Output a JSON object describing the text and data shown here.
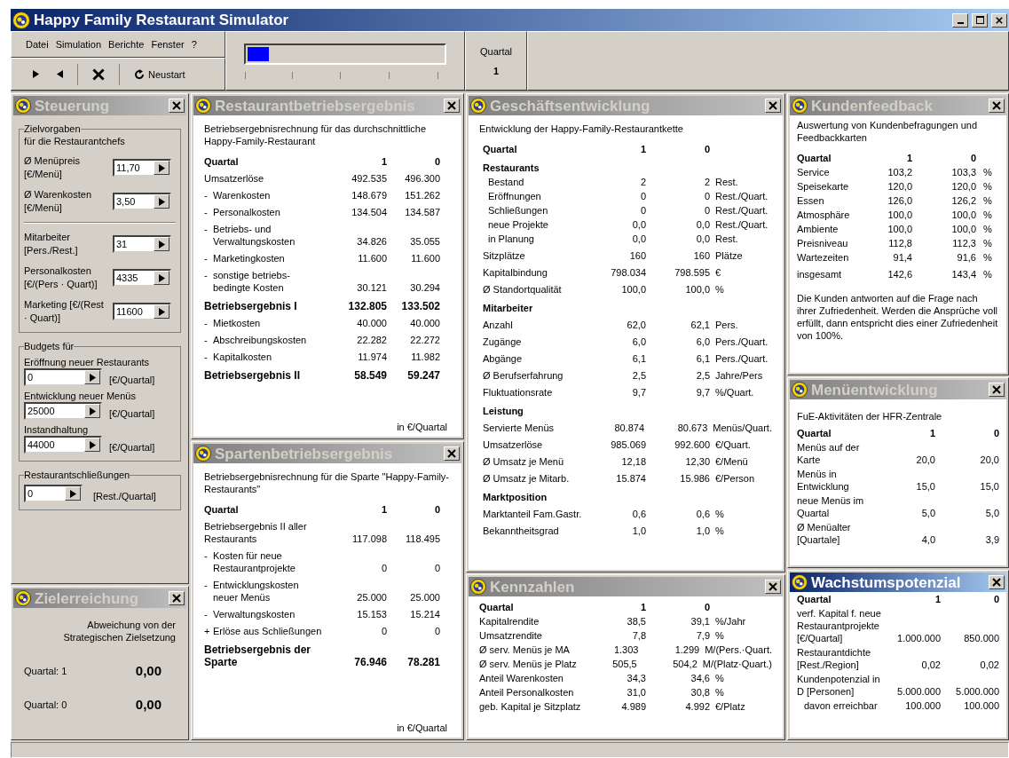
{
  "window": {
    "title": "Happy Family Restaurant Simulator"
  },
  "menu": [
    "Datei",
    "Simulation",
    "Berichte",
    "Fenster",
    "?"
  ],
  "toolbar": {
    "restart": "Neustart"
  },
  "progress": {
    "level": 0.11
  },
  "quarter": {
    "label": "Quartal",
    "value": "1"
  },
  "steuerung": {
    "title": "Steuerung",
    "selected": false,
    "groups": [
      {
        "legend": "Zielvorgaben",
        "subtitle": "für die Restaurantchefs",
        "fields": [
          {
            "kind": "side",
            "label": "Ø Menüpreis [€/Menü]",
            "value": "11,70"
          },
          {
            "kind": "side",
            "label": "Ø Warenkosten [€/Menü]",
            "value": "3,50"
          },
          {
            "kind": "separator"
          },
          {
            "kind": "side",
            "label": "Mitarbeiter [Pers./Rest.]",
            "value": "31"
          },
          {
            "kind": "side",
            "label": "Personalkosten [€/(Pers · Quart)]",
            "value": "4335"
          },
          {
            "kind": "side",
            "label": "Marketing [€/(Rest · Quart)]",
            "value": "11600"
          }
        ]
      },
      {
        "legend": "Budgets für",
        "fields": [
          {
            "kind": "stacked",
            "label": "Eröffnung neuer Restaurants",
            "value": "0",
            "unit": "[€/Quartal]"
          },
          {
            "kind": "stacked",
            "label": "Entwicklung neuer Menüs",
            "value": "25000",
            "unit": "[€/Quartal]"
          },
          {
            "kind": "stacked",
            "label": "Instandhaltung",
            "value": "44000",
            "unit": "[€/Quartal]"
          }
        ]
      },
      {
        "legend": "Restaurantschließungen",
        "fields": [
          {
            "kind": "inline",
            "value": "0",
            "unit": "[Rest./Quartal]"
          }
        ]
      }
    ]
  },
  "zielerreichung": {
    "title": "Zielerreichung",
    "selected": false,
    "note": "Abweichung von der Strategischen Zielsetzung",
    "rows": [
      {
        "label": "Quartal: 1",
        "value": "0,00"
      },
      {
        "label": "Quartal: 0",
        "value": "0,00"
      }
    ]
  },
  "restaurant": {
    "title": "Restaurantbetriebsergebnis",
    "selected": false,
    "intro": "Betriebsergebnisrechnung für das durchschnittliche Happy-Family-Restaurant",
    "footer": "in €/Quartal",
    "rows": [
      {
        "kind": "head",
        "label": "Quartal",
        "v1": "1",
        "v0": "0"
      },
      {
        "kind": "row",
        "label": "Umsatzerlöse",
        "v1": "492.535",
        "v0": "496.300"
      },
      {
        "kind": "row",
        "prefix": "-",
        "label": "Warenkosten",
        "v1": "148.679",
        "v0": "151.262"
      },
      {
        "kind": "row",
        "prefix": "-",
        "label": "Personalkosten",
        "v1": "134.504",
        "v0": "134.587"
      },
      {
        "kind": "row",
        "prefix": "-",
        "label": "Betriebs- und Verwaltungskosten",
        "v1": "34.826",
        "v0": "35.055"
      },
      {
        "kind": "row",
        "prefix": "-",
        "label": "Marketingkosten",
        "v1": "11.600",
        "v0": "11.600"
      },
      {
        "kind": "row",
        "prefix": "-",
        "label": "sonstige betriebs-bedingte Kosten",
        "v1": "30.121",
        "v0": "30.294"
      },
      {
        "kind": "bold",
        "label": "Betriebsergebnis I",
        "v1": "132.805",
        "v0": "133.502"
      },
      {
        "kind": "row",
        "prefix": "-",
        "label": "Mietkosten",
        "v1": "40.000",
        "v0": "40.000"
      },
      {
        "kind": "row",
        "prefix": "-",
        "label": "Abschreibungskosten",
        "v1": "22.282",
        "v0": "22.272"
      },
      {
        "kind": "row",
        "prefix": "-",
        "label": "Kapitalkosten",
        "v1": "11.974",
        "v0": "11.982"
      },
      {
        "kind": "bold",
        "label": "Betriebsergebnis II",
        "v1": "58.549",
        "v0": "59.247"
      }
    ]
  },
  "sparten": {
    "title": "Spartenbetriebsergebnis",
    "selected": false,
    "intro": "Betriebsergebnisrechnung für die Sparte \"Happy-Family-Restaurants\"",
    "footer": "in €/Quartal",
    "rows": [
      {
        "kind": "head",
        "label": "Quartal",
        "v1": "1",
        "v0": "0"
      },
      {
        "kind": "row",
        "label": "Betriebsergebnis II aller Restaurants",
        "v1": "117.098",
        "v0": "118.495"
      },
      {
        "kind": "row",
        "prefix": "-",
        "label": "Kosten für neue Restaurantprojekte",
        "v1": "0",
        "v0": "0"
      },
      {
        "kind": "row",
        "prefix": "-",
        "label": "Entwicklungskosten neuer Menüs",
        "v1": "25.000",
        "v0": "25.000"
      },
      {
        "kind": "row",
        "prefix": "-",
        "label": "Verwaltungskosten",
        "v1": "15.153",
        "v0": "15.214"
      },
      {
        "kind": "row",
        "prefix": "+",
        "label": "Erlöse aus Schließungen",
        "v1": "0",
        "v0": "0"
      },
      {
        "kind": "bold",
        "label": "Betriebsergebnis der Sparte",
        "v1": "76.946",
        "v0": "78.281"
      }
    ]
  },
  "geschaeft": {
    "title": "Geschäftsentwicklung",
    "selected": false,
    "intro": "Entwicklung der Happy-Family-Restaurantkette",
    "rows": [
      {
        "kind": "head",
        "label": "Quartal",
        "v1": "1",
        "v0": "0"
      },
      {
        "kind": "section",
        "label": "Restaurants"
      },
      {
        "kind": "sub",
        "label": "Bestand",
        "v1": "2",
        "v0": "2",
        "unit": "Rest."
      },
      {
        "kind": "sub",
        "label": "Eröffnungen",
        "v1": "0",
        "v0": "0",
        "unit": "Rest./Quart."
      },
      {
        "kind": "sub",
        "label": "Schließungen",
        "v1": "0",
        "v0": "0",
        "unit": "Rest./Quart."
      },
      {
        "kind": "sub",
        "label": "neue Projekte",
        "v1": "0,0",
        "v0": "0,0",
        "unit": "Rest./Quart."
      },
      {
        "kind": "sub",
        "label": "in Planung",
        "v1": "0,0",
        "v0": "0,0",
        "unit": "Rest."
      },
      {
        "kind": "row",
        "label": "Sitzplätze",
        "v1": "160",
        "v0": "160",
        "unit": "Plätze"
      },
      {
        "kind": "row",
        "label": "Kapitalbindung",
        "v1": "798.034",
        "v0": "798.595",
        "unit": "€"
      },
      {
        "kind": "row",
        "label": "Ø Standortqualität",
        "v1": "100,0",
        "v0": "100,0",
        "unit": "%"
      },
      {
        "kind": "section",
        "label": "Mitarbeiter"
      },
      {
        "kind": "row",
        "label": "Anzahl",
        "v1": "62,0",
        "v0": "62,1",
        "unit": "Pers."
      },
      {
        "kind": "row",
        "label": "Zugänge",
        "v1": "6,0",
        "v0": "6,0",
        "unit": "Pers./Quart."
      },
      {
        "kind": "row",
        "label": "Abgänge",
        "v1": "6,1",
        "v0": "6,1",
        "unit": "Pers./Quart."
      },
      {
        "kind": "row",
        "label": "Ø Berufserfahrung",
        "v1": "2,5",
        "v0": "2,5",
        "unit": "Jahre/Pers"
      },
      {
        "kind": "row",
        "label": "Fluktuationsrate",
        "v1": "9,7",
        "v0": "9,7",
        "unit": "%/Quart."
      },
      {
        "kind": "section",
        "label": "Leistung"
      },
      {
        "kind": "row",
        "label": "Servierte Menüs",
        "v1": "80.874",
        "v0": "80.673",
        "unit": "Menüs/Quart."
      },
      {
        "kind": "row",
        "label": "Umsatzerlöse",
        "v1": "985.069",
        "v0": "992.600",
        "unit": "€/Quart."
      },
      {
        "kind": "row",
        "label": "Ø Umsatz je Menü",
        "v1": "12,18",
        "v0": "12,30",
        "unit": "€/Menü"
      },
      {
        "kind": "row",
        "label": "Ø Umsatz je Mitarb.",
        "v1": "15.874",
        "v0": "15.986",
        "unit": "€/Person"
      },
      {
        "kind": "section",
        "label": "Marktposition"
      },
      {
        "kind": "row",
        "label": "Marktanteil Fam.Gastr.",
        "v1": "0,6",
        "v0": "0,6",
        "unit": "%"
      },
      {
        "kind": "row",
        "label": "Bekanntheitsgrad",
        "v1": "1,0",
        "v0": "1,0",
        "unit": "%"
      }
    ]
  },
  "kennzahlen": {
    "title": "Kennzahlen",
    "selected": false,
    "rows": [
      {
        "kind": "head",
        "label": "Quartal",
        "v1": "1",
        "v0": "0"
      },
      {
        "kind": "flat",
        "label": "Kapitalrendite",
        "v1": "38,5",
        "v0": "39,1",
        "unit": "%/Jahr"
      },
      {
        "kind": "flat",
        "label": "Umsatzrendite",
        "v1": "7,8",
        "v0": "7,9",
        "unit": "%"
      },
      {
        "kind": "flat",
        "label": "Ø serv. Menüs je MA",
        "v1": "1.303",
        "v0": "1.299",
        "unit": "M/(Pers.·Quart."
      },
      {
        "kind": "flat",
        "label": "Ø serv. Menüs je Platz",
        "v1": "505,5",
        "v0": "504,2",
        "unit": "M/(Platz·Quart.)"
      },
      {
        "kind": "flat",
        "label": "Anteil Warenkosten",
        "v1": "34,3",
        "v0": "34,6",
        "unit": "%"
      },
      {
        "kind": "flat",
        "label": "Anteil Personalkosten",
        "v1": "31,0",
        "v0": "30,8",
        "unit": "%"
      },
      {
        "kind": "flat",
        "label": "geb. Kapital je Sitzplatz",
        "v1": "4.989",
        "v0": "4.992",
        "unit": "€/Platz"
      }
    ]
  },
  "kunden": {
    "title": "Kundenfeedback",
    "selected": false,
    "intro": "Auswertung von Kundenbefragungen und Feedbackkarten",
    "note": "Die Kunden antworten auf die Frage nach ihrer Zufriedenheit. Werden die Ansprüche voll erfüllt, dann entspricht dies einer Zufriedenheit von 100%.",
    "rows": [
      {
        "kind": "head",
        "label": "Quartal",
        "v1": "1",
        "v0": "0"
      },
      {
        "kind": "flat",
        "label": "Service",
        "v1": "103,2",
        "v0": "103,3",
        "unit": "%"
      },
      {
        "kind": "flat",
        "label": "Speisekarte",
        "v1": "120,0",
        "v0": "120,0",
        "unit": "%"
      },
      {
        "kind": "flat",
        "label": "Essen",
        "v1": "126,0",
        "v0": "126,2",
        "unit": "%"
      },
      {
        "kind": "flat",
        "label": "Atmosphäre",
        "v1": "100,0",
        "v0": "100,0",
        "unit": "%"
      },
      {
        "kind": "flat",
        "label": "Ambiente",
        "v1": "100,0",
        "v0": "100,0",
        "unit": "%"
      },
      {
        "kind": "flat",
        "label": "Preisniveau",
        "v1": "112,8",
        "v0": "112,3",
        "unit": "%"
      },
      {
        "kind": "flat",
        "label": "Wartezeiten",
        "v1": "91,4",
        "v0": "91,6",
        "unit": "%"
      },
      {
        "kind": "row",
        "label": "insgesamt",
        "v1": "142,6",
        "v0": "143,4",
        "unit": "%"
      }
    ]
  },
  "menue": {
    "title": "Menüentwicklung",
    "selected": false,
    "intro": "FuE-Aktivitäten der HFR-Zentrale",
    "rows": [
      {
        "kind": "head",
        "label": "Quartal",
        "v1": "1",
        "v0": "0"
      },
      {
        "kind": "flat",
        "label": "Menüs auf der Karte",
        "v1": "20,0",
        "v0": "20,0"
      },
      {
        "kind": "flat",
        "label": "Menüs in Entwicklung",
        "v1": "15,0",
        "v0": "15,0"
      },
      {
        "kind": "flat",
        "label": "neue Menüs im Quartal",
        "v1": "5,0",
        "v0": "5,0"
      },
      {
        "kind": "flat",
        "label": "Ø Menüalter [Quartale]",
        "v1": "4,0",
        "v0": "3,9"
      }
    ]
  },
  "wachstum": {
    "title": "Wachstumspotenzial",
    "selected": true,
    "rows": [
      {
        "kind": "head",
        "label": "Quartal",
        "v1": "1",
        "v0": "0"
      },
      {
        "kind": "flat",
        "label": "verf. Kapital f. neue Restaurantprojekte [€/Quartal]",
        "v1": "1.000.000",
        "v0": "850.000"
      },
      {
        "kind": "flat",
        "label": "Restaurantdichte [Rest./Region]",
        "v1": "0,02",
        "v0": "0,02"
      },
      {
        "kind": "flat",
        "label": "Kundenpotenzial in D [Personen]",
        "v1": "5.000.000",
        "v0": "5.000.000"
      },
      {
        "kind": "sub",
        "label": "davon erreichbar",
        "v1": "100.000",
        "v0": "100.000"
      }
    ]
  }
}
